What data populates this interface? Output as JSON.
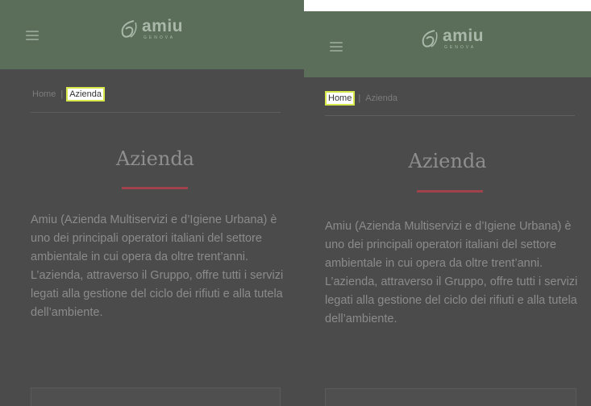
{
  "left": {
    "logo_word": "amiu",
    "logo_sub": "GENOVA",
    "breadcrumb": {
      "home": "Home",
      "sep": "|",
      "current": "Azienda"
    },
    "title": "Azienda",
    "body": "Amiu (Azienda Multiservizi e d’Igiene Urbana) è uno dei principali operatori italiani del settore ambientale in cui opera da oltre trent’anni. L’azienda, attraverso il Gruppo, offre tutti i servizi legati alla gestione del ciclo dei rifiuti e alla tutela dell’ambiente.",
    "highlighted": "Azienda"
  },
  "right": {
    "logo_word": "amiu",
    "logo_sub": "GENOVA",
    "breadcrumb": {
      "home": "Home",
      "sep": "|",
      "current": "Azienda"
    },
    "title": "Azienda",
    "body": "Amiu (Azienda Multiservizi e d’Igiene Urbana) è uno dei principali operatori italiani del settore ambientale in cui opera da oltre trent’anni. L’azienda, attraverso il Gruppo, offre tutti i servizi legati alla gestione del ciclo dei rifiuti e alla tutela dell’ambiente.",
    "highlighted": "Home"
  },
  "colors": {
    "header": "#5a6e5a",
    "overlay": "#4b4b4b",
    "accent": "#a0424b",
    "highlight": "#d6e84a"
  },
  "icons": [
    "menu-icon",
    "amiu-logo-icon"
  ]
}
